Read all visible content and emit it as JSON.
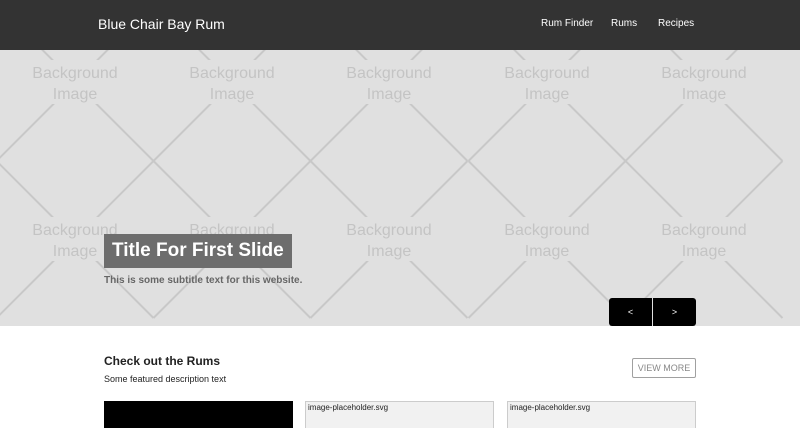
{
  "navbar": {
    "brand": "Blue Chair Bay Rum",
    "links": [
      "Rum Finder",
      "Rums",
      "Recipes"
    ]
  },
  "hero": {
    "background_label_line1": "Background",
    "background_label_line2": "Image",
    "slide_title": "Title For First Slide",
    "slide_subtitle": "This is some subtitle text for this website.",
    "prev_label": "<",
    "next_label": ">"
  },
  "section": {
    "title": "Check out the Rums",
    "description": "Some featured description text",
    "view_more_label": "VIEW MORE"
  },
  "cards": [
    {
      "type": "image",
      "label": ""
    },
    {
      "type": "placeholder",
      "label": "image-placeholder.svg"
    },
    {
      "type": "placeholder",
      "label": "image-placeholder.svg"
    }
  ],
  "colors": {
    "navbar_bg": "#333333",
    "hero_bg": "#e0e0e0",
    "title_bg": "#6d6d6d",
    "control_bg": "#000000"
  }
}
